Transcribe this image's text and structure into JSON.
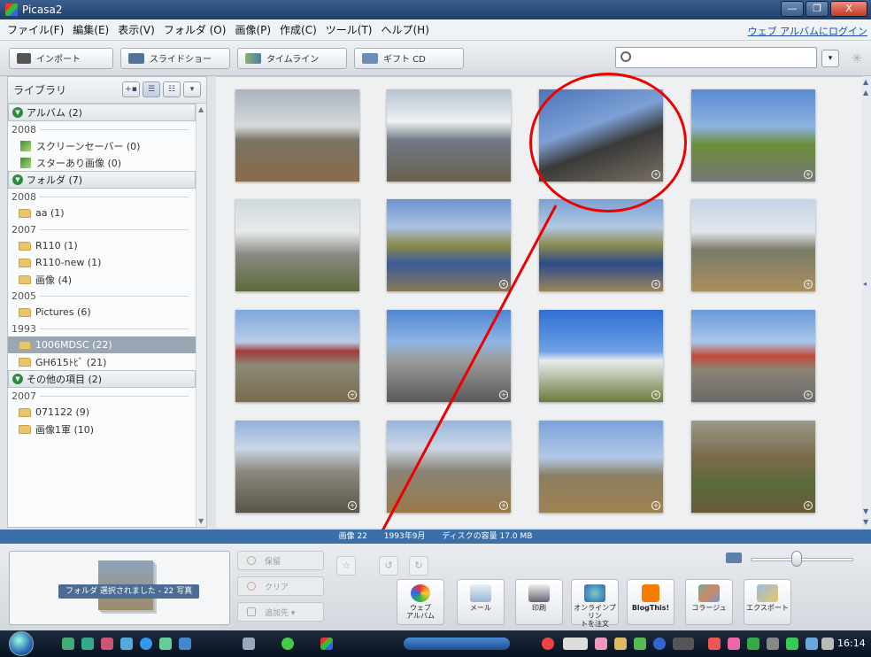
{
  "window": {
    "title": "Picasa2",
    "min": "—",
    "max": "❐",
    "close": "X"
  },
  "menu": {
    "items": [
      "ファイル(F)",
      "編集(E)",
      "表示(V)",
      "フォルダ (O)",
      "画像(P)",
      "作成(C)",
      "ツール(T)",
      "ヘルプ(H)"
    ],
    "web_album_login": "ウェブ アルバムにログイン"
  },
  "toolbar": {
    "import_label": "インポート",
    "slideshow_label": "スライドショー",
    "timeline_label": "タイムライン",
    "giftcd_label": "ギフト CD",
    "search_placeholder": ""
  },
  "library": {
    "title": "ライブラリ",
    "groups": [
      {
        "label": "アルバム (2)",
        "sections": [
          {
            "year": "2008",
            "items": [
              "スクリーンセーバー (0)",
              "スターあり画像 (0)"
            ]
          }
        ]
      },
      {
        "label": "フォルダ (7)",
        "sections": [
          {
            "year": "2008",
            "items": [
              "aa (1)"
            ]
          },
          {
            "year": "2007",
            "items": [
              "R110 (1)",
              "R110-new (1)",
              "画像 (4)"
            ]
          },
          {
            "year": "2005",
            "items": [
              "Pictures (6)"
            ]
          },
          {
            "year": "1993",
            "items": [
              "1006MDSC (22)",
              "GH615ﾄﾋﾞ (21)"
            ]
          }
        ]
      },
      {
        "label": "その他の項目 (2)",
        "sections": [
          {
            "year": "2007",
            "items": [
              "071122 (9)",
              "画像1軍 (10)"
            ]
          }
        ]
      }
    ]
  },
  "status": {
    "count": "画像 22",
    "date": "1993年9月",
    "disk": "ディスクの容量 17.0 MB"
  },
  "tray": {
    "hold_label": "フォルダ 選択されました - 22 写真",
    "hold_button": "保留",
    "clear_button": "クリア",
    "add_button": "追加先 ▾",
    "actions": [
      "ウェブ\nアルバム",
      "メール",
      "印刷",
      "オンラインプリン\nトを注文",
      "BlogThis!",
      "コラージュ",
      "エクスポート"
    ]
  },
  "zoom": 0.45,
  "clock": "16:14",
  "colors": {
    "accent": "#3b6fa8",
    "highlight": "#e00000"
  }
}
